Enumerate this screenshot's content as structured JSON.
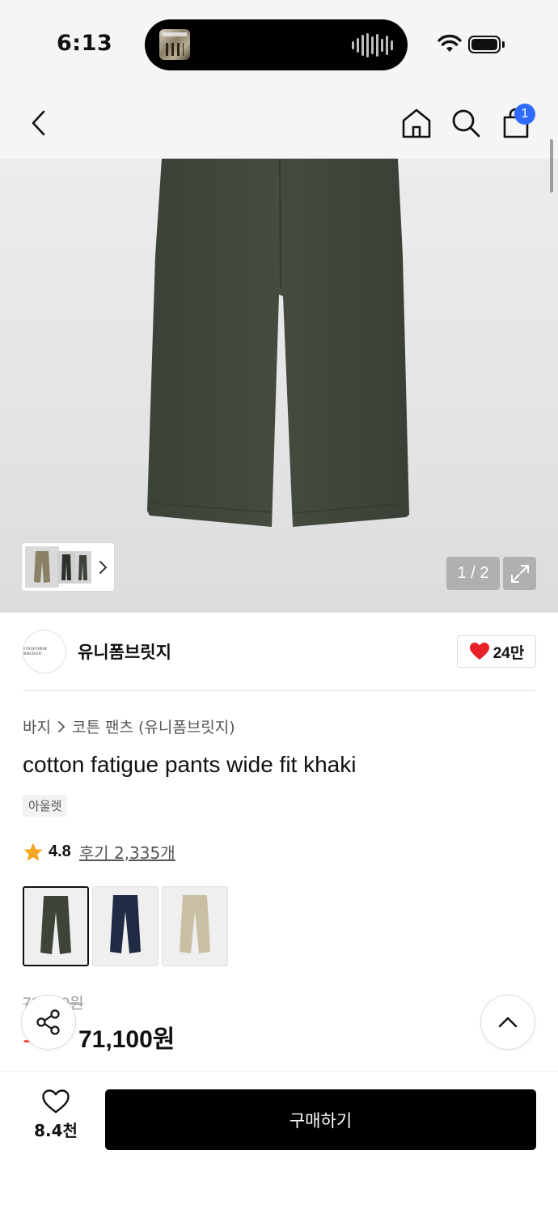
{
  "status_bar": {
    "time": "6:13"
  },
  "header": {
    "cart_badge": "1"
  },
  "gallery": {
    "page_counter": "1 / 2"
  },
  "brand": {
    "logo_text": "UNIFORM BRIDGE",
    "name": "유니폼브릿지",
    "like_count": "24만"
  },
  "product": {
    "breadcrumb": [
      "바지",
      "코튼 팬츠 (유니폼브릿지)"
    ],
    "title": "cotton fatigue pants wide fit khaki",
    "tag": "아울렛",
    "rating": "4.8",
    "review_link": "후기 2,335개",
    "swatches": [
      {
        "color": "#3e4438",
        "selected": true
      },
      {
        "color": "#1f2b44",
        "selected": false
      },
      {
        "color": "#c9bfa2",
        "selected": false
      }
    ],
    "original_price": "79,000원",
    "discount": "10%",
    "sale_price": "71,100원"
  },
  "bottom_bar": {
    "wish_count": "8.4천",
    "buy_label": "구매하기"
  },
  "colors": {
    "accent_badge": "#2f6bff",
    "heart": "#e8202a",
    "star": "#f5a623",
    "discount": "#ff3b30",
    "buy_button": "#000000"
  }
}
